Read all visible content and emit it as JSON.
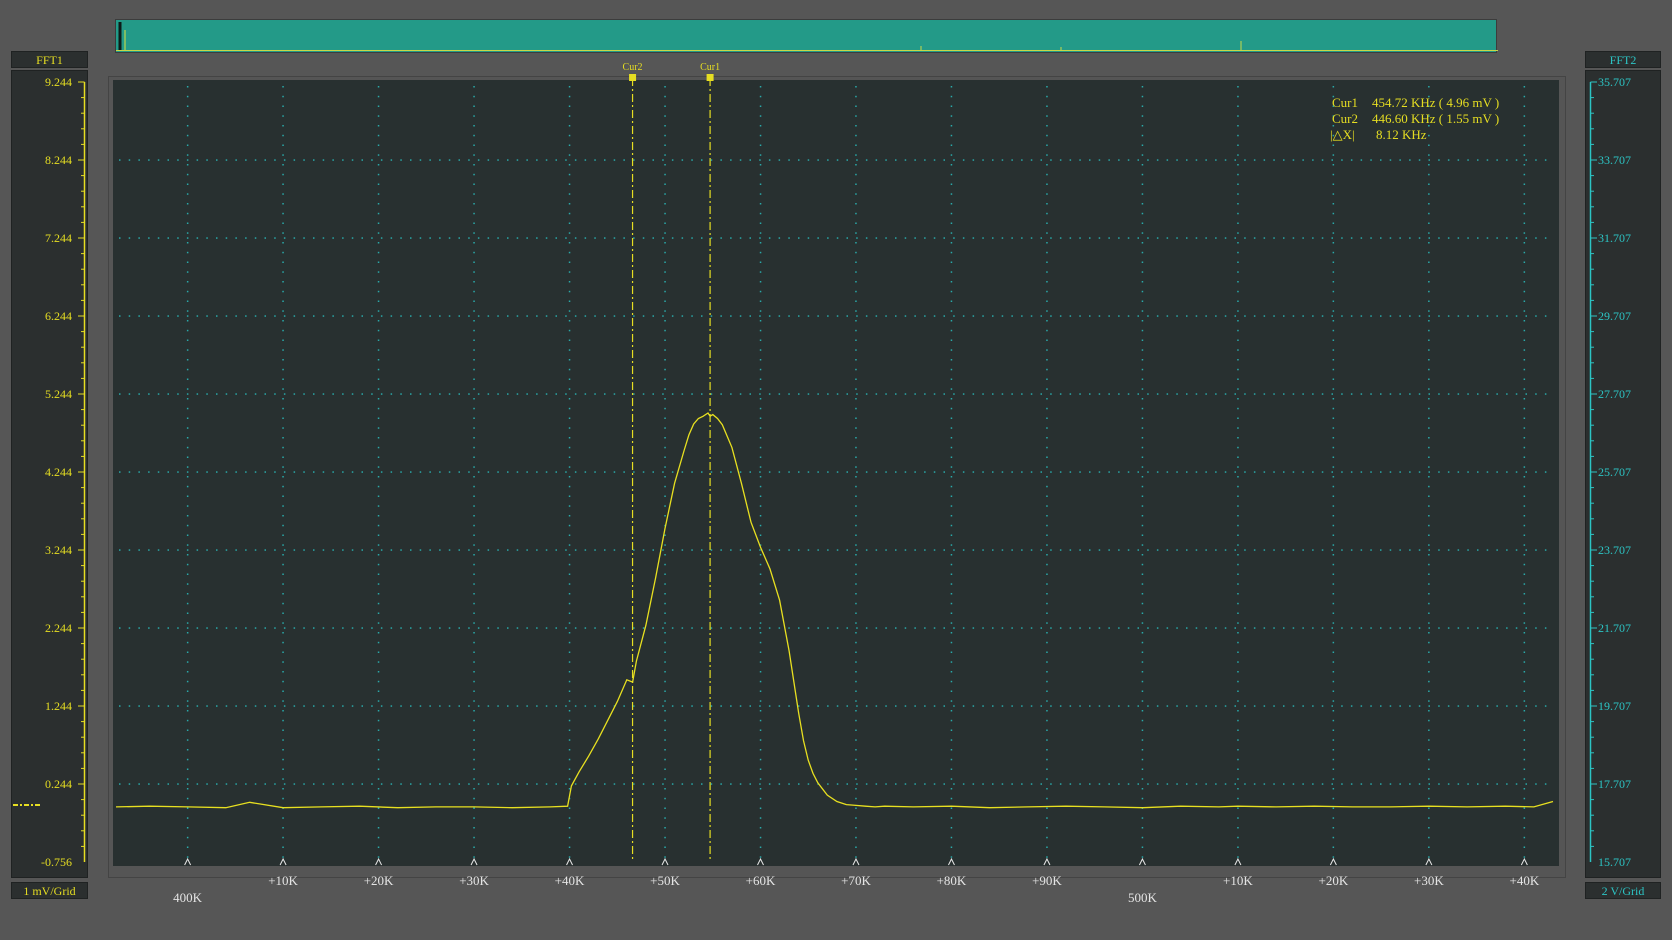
{
  "left_axis": {
    "channel": "FFT1",
    "scale": "1 mV/Grid",
    "ticks": [
      "9.244",
      "8.244",
      "7.244",
      "6.244",
      "5.244",
      "4.244",
      "3.244",
      "2.244",
      "1.244",
      "0.244",
      "-0.756"
    ]
  },
  "right_axis": {
    "channel": "FFT2",
    "scale": "2 V/Grid",
    "ticks": [
      "35.707",
      "33.707",
      "31.707",
      "29.707",
      "27.707",
      "25.707",
      "23.707",
      "21.707",
      "19.707",
      "17.707",
      "15.707"
    ]
  },
  "cursors": [
    {
      "label": "Cur2",
      "x_khz": 446.6
    },
    {
      "label": "Cur1",
      "x_khz": 454.72
    }
  ],
  "readout": {
    "cur1": {
      "name": "Cur1",
      "value": "454.72 KHz ( 4.96 mV )"
    },
    "cur2": {
      "name": "Cur2",
      "value": "446.60 KHz ( 1.55 mV )"
    },
    "delta": {
      "name": "|△X|",
      "value": "8.12 KHz"
    }
  },
  "colors": {
    "trace": "#e8e020",
    "left_axis": "#e6de22",
    "right_axis": "#2cc4c4",
    "grid_dot": "#2aa8a8",
    "plot_bg": "#283030",
    "overview_bg": "#239a88"
  },
  "chart_data": {
    "type": "line",
    "title": "",
    "xlabel": "",
    "ylabel": "",
    "x_unit": "KHz",
    "y_unit": "mV",
    "xlim": [
      392.5,
      543.0
    ],
    "ylim": [
      -0.756,
      9.244
    ],
    "grid": true,
    "x_tick_values": [
      400,
      410,
      420,
      430,
      440,
      450,
      460,
      470,
      480,
      490,
      500,
      510,
      520,
      530,
      540
    ],
    "x_tick_labels": [
      "",
      "+10K",
      "+20K",
      "+30K",
      "+40K",
      "+50K",
      "+60K",
      "+70K",
      "+80K",
      "+90K",
      "",
      "+10K",
      "+20K",
      "+30K",
      "+40K"
    ],
    "x_major_labels": [
      {
        "value": 400,
        "label": "400K"
      },
      {
        "value": 500,
        "label": "500K"
      }
    ],
    "series": [
      {
        "x": [
          392.5,
          396,
          400,
          404,
          406.5,
          410,
          414,
          418,
          422,
          426,
          430,
          434,
          438,
          439.8,
          440.2,
          441,
          442,
          443,
          444,
          445,
          446,
          446.6,
          447,
          448,
          449,
          450,
          451,
          452,
          452.5,
          453,
          453.5,
          454,
          454.5,
          454.72,
          455,
          455.5,
          456,
          457,
          458,
          459,
          460,
          461,
          462,
          463,
          463.5,
          464,
          464.5,
          465,
          465.5,
          466,
          467,
          468,
          469,
          470,
          471,
          472,
          473,
          476,
          480,
          484,
          488,
          492,
          496,
          500,
          504,
          508,
          510,
          514,
          518,
          522,
          526,
          530,
          534,
          538,
          541,
          543
        ],
        "y": [
          -0.05,
          -0.04,
          -0.05,
          -0.06,
          0.01,
          -0.06,
          -0.05,
          -0.04,
          -0.06,
          -0.05,
          -0.05,
          -0.06,
          -0.05,
          -0.04,
          0.22,
          0.4,
          0.6,
          0.82,
          1.06,
          1.3,
          1.58,
          1.55,
          1.82,
          2.28,
          2.88,
          3.52,
          4.1,
          4.52,
          4.72,
          4.86,
          4.93,
          4.96,
          5.0,
          4.96,
          4.98,
          4.93,
          4.85,
          4.56,
          4.1,
          3.6,
          3.28,
          3.0,
          2.6,
          1.95,
          1.55,
          1.15,
          0.8,
          0.55,
          0.38,
          0.26,
          0.1,
          0.02,
          -0.02,
          -0.03,
          -0.04,
          -0.05,
          -0.04,
          -0.05,
          -0.04,
          -0.06,
          -0.05,
          -0.04,
          -0.05,
          -0.06,
          -0.04,
          -0.05,
          -0.04,
          -0.05,
          -0.04,
          -0.05,
          -0.05,
          -0.04,
          -0.05,
          -0.04,
          -0.05,
          0.02
        ]
      }
    ]
  }
}
